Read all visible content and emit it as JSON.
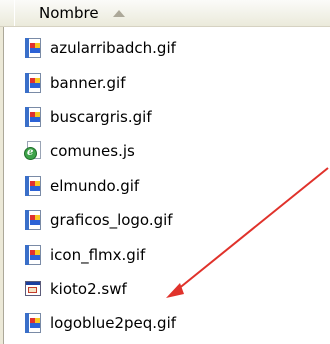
{
  "header": {
    "column_label": "Nombre",
    "sort_icon": "sort-ascending-icon"
  },
  "files": [
    {
      "name": "azularribadch.gif",
      "icon": "gif-file-icon"
    },
    {
      "name": "banner.gif",
      "icon": "gif-file-icon"
    },
    {
      "name": "buscargris.gif",
      "icon": "gif-file-icon"
    },
    {
      "name": "comunes.js",
      "icon": "js-file-icon"
    },
    {
      "name": "elmundo.gif",
      "icon": "gif-file-icon"
    },
    {
      "name": "graficos_logo.gif",
      "icon": "gif-file-icon"
    },
    {
      "name": "icon_flmx.gif",
      "icon": "gif-file-icon"
    },
    {
      "name": "kioto2.swf",
      "icon": "swf-file-icon"
    },
    {
      "name": "logoblue2peq.gif",
      "icon": "gif-file-icon"
    }
  ],
  "annotation": {
    "arrow_color": "#e0322b",
    "points_to": "kioto2.swf"
  }
}
